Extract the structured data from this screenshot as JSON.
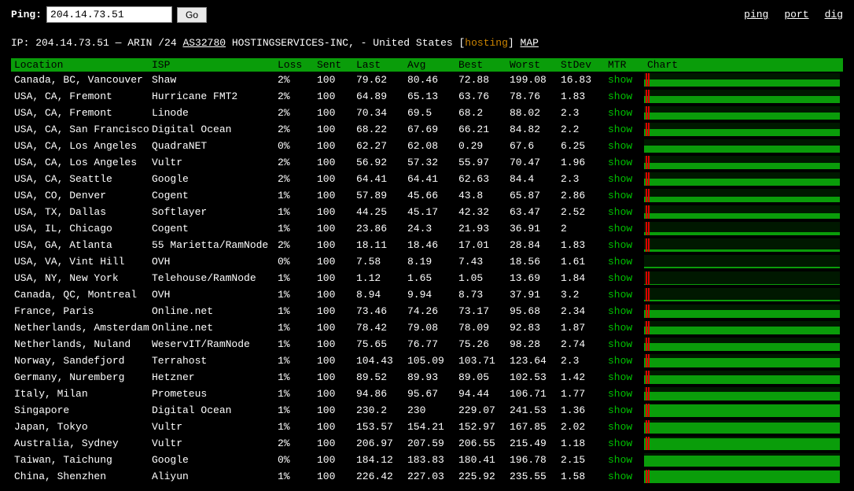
{
  "topbar": {
    "ping_label": "Ping:",
    "ip_value": "204.14.73.51",
    "go_label": "Go",
    "links": {
      "ping": "ping",
      "port": "port",
      "dig": "dig"
    }
  },
  "info": {
    "prefix": "IP: 204.14.73.51 — ARIN /24 ",
    "asn": "AS32780",
    "mid": " HOSTINGSERVICES-INC, - United States [",
    "hosting": "hosting",
    "after_hosting": "] ",
    "map": "MAP"
  },
  "headers": {
    "location": "Location",
    "isp": "ISP",
    "loss": "Loss",
    "sent": "Sent",
    "last": "Last",
    "avg": "Avg",
    "best": "Best",
    "worst": "Worst",
    "stdev": "StDev",
    "mtr": "MTR",
    "chart": "Chart"
  },
  "mtr_label": "show",
  "rows": [
    {
      "location": "Canada, BC, Vancouver",
      "isp": "Shaw",
      "loss": "2%",
      "sent": "100",
      "last": "79.62",
      "avg": "80.46",
      "best": "72.88",
      "worst": "199.08",
      "stdev": "16.83",
      "fill": 55,
      "red": true
    },
    {
      "location": "USA, CA, Fremont",
      "isp": "Hurricane FMT2",
      "loss": "2%",
      "sent": "100",
      "last": "64.89",
      "avg": "65.13",
      "best": "63.76",
      "worst": "78.76",
      "stdev": "1.83",
      "fill": 55,
      "red": true
    },
    {
      "location": "USA, CA, Fremont",
      "isp": "Linode",
      "loss": "2%",
      "sent": "100",
      "last": "70.34",
      "avg": "69.5",
      "best": "68.2",
      "worst": "88.02",
      "stdev": "2.3",
      "fill": 55,
      "red": true
    },
    {
      "location": "USA, CA, San Francisco",
      "isp": "Digital Ocean",
      "loss": "2%",
      "sent": "100",
      "last": "68.22",
      "avg": "67.69",
      "best": "66.21",
      "worst": "84.82",
      "stdev": "2.2",
      "fill": 55,
      "red": true
    },
    {
      "location": "USA, CA, Los Angeles",
      "isp": "QuadraNET",
      "loss": "0%",
      "sent": "100",
      "last": "62.27",
      "avg": "62.08",
      "best": "0.29",
      "worst": "67.6",
      "stdev": "6.25",
      "fill": 55,
      "red": false
    },
    {
      "location": "USA, CA, Los Angeles",
      "isp": "Vultr",
      "loss": "2%",
      "sent": "100",
      "last": "56.92",
      "avg": "57.32",
      "best": "55.97",
      "worst": "70.47",
      "stdev": "1.96",
      "fill": 50,
      "red": true
    },
    {
      "location": "USA, CA, Seattle",
      "isp": "Google",
      "loss": "2%",
      "sent": "100",
      "last": "64.41",
      "avg": "64.41",
      "best": "62.63",
      "worst": "84.4",
      "stdev": "2.3",
      "fill": 55,
      "red": true
    },
    {
      "location": "USA, CO, Denver",
      "isp": "Cogent",
      "loss": "1%",
      "sent": "100",
      "last": "57.89",
      "avg": "45.66",
      "best": "43.8",
      "worst": "65.87",
      "stdev": "2.86",
      "fill": 40,
      "red": true
    },
    {
      "location": "USA, TX, Dallas",
      "isp": "Softlayer",
      "loss": "1%",
      "sent": "100",
      "last": "44.25",
      "avg": "45.17",
      "best": "42.32",
      "worst": "63.47",
      "stdev": "2.52",
      "fill": 40,
      "red": true
    },
    {
      "location": "USA, IL, Chicago",
      "isp": "Cogent",
      "loss": "1%",
      "sent": "100",
      "last": "23.86",
      "avg": "24.3",
      "best": "21.93",
      "worst": "36.91",
      "stdev": "2",
      "fill": 25,
      "red": true
    },
    {
      "location": "USA, GA, Atlanta",
      "isp": "55 Marietta/RamNode",
      "loss": "2%",
      "sent": "100",
      "last": "18.11",
      "avg": "18.46",
      "best": "17.01",
      "worst": "28.84",
      "stdev": "1.83",
      "fill": 20,
      "red": true
    },
    {
      "location": "USA, VA, Vint Hill",
      "isp": "OVH",
      "loss": "0%",
      "sent": "100",
      "last": "7.58",
      "avg": "8.19",
      "best": "7.43",
      "worst": "18.56",
      "stdev": "1.61",
      "fill": 12,
      "red": false
    },
    {
      "location": "USA, NY, New York",
      "isp": "Telehouse/RamNode",
      "loss": "1%",
      "sent": "100",
      "last": "1.12",
      "avg": "1.65",
      "best": "1.05",
      "worst": "13.69",
      "stdev": "1.84",
      "fill": 8,
      "red": true
    },
    {
      "location": "Canada, QC, Montreal",
      "isp": "OVH",
      "loss": "1%",
      "sent": "100",
      "last": "8.94",
      "avg": "9.94",
      "best": "8.73",
      "worst": "37.91",
      "stdev": "3.2",
      "fill": 14,
      "red": true
    },
    {
      "location": "France, Paris",
      "isp": "Online.net",
      "loss": "1%",
      "sent": "100",
      "last": "73.46",
      "avg": "74.26",
      "best": "73.17",
      "worst": "95.68",
      "stdev": "2.34",
      "fill": 58,
      "red": true
    },
    {
      "location": "Netherlands, Amsterdam",
      "isp": "Online.net",
      "loss": "1%",
      "sent": "100",
      "last": "78.42",
      "avg": "79.08",
      "best": "78.09",
      "worst": "92.83",
      "stdev": "1.87",
      "fill": 60,
      "red": true
    },
    {
      "location": "Netherlands, Nuland",
      "isp": "WeservIT/RamNode",
      "loss": "1%",
      "sent": "100",
      "last": "75.65",
      "avg": "76.77",
      "best": "75.26",
      "worst": "98.28",
      "stdev": "2.74",
      "fill": 58,
      "red": true
    },
    {
      "location": "Norway, Sandefjord",
      "isp": "Terrahost",
      "loss": "1%",
      "sent": "100",
      "last": "104.43",
      "avg": "105.09",
      "best": "103.71",
      "worst": "123.64",
      "stdev": "2.3",
      "fill": 70,
      "red": true
    },
    {
      "location": "Germany, Nuremberg",
      "isp": "Hetzner",
      "loss": "1%",
      "sent": "100",
      "last": "89.52",
      "avg": "89.93",
      "best": "89.05",
      "worst": "102.53",
      "stdev": "1.42",
      "fill": 65,
      "red": true
    },
    {
      "location": "Italy, Milan",
      "isp": "Prometeus",
      "loss": "1%",
      "sent": "100",
      "last": "94.86",
      "avg": "95.67",
      "best": "94.44",
      "worst": "106.71",
      "stdev": "1.77",
      "fill": 67,
      "red": true
    },
    {
      "location": "Singapore",
      "isp": "Digital Ocean",
      "loss": "1%",
      "sent": "100",
      "last": "230.2",
      "avg": "230",
      "best": "229.07",
      "worst": "241.53",
      "stdev": "1.36",
      "fill": 95,
      "red": true
    },
    {
      "location": "Japan, Tokyo",
      "isp": "Vultr",
      "loss": "1%",
      "sent": "100",
      "last": "153.57",
      "avg": "154.21",
      "best": "152.97",
      "worst": "167.85",
      "stdev": "2.02",
      "fill": 80,
      "red": true
    },
    {
      "location": "Australia, Sydney",
      "isp": "Vultr",
      "loss": "2%",
      "sent": "100",
      "last": "206.97",
      "avg": "207.59",
      "best": "206.55",
      "worst": "215.49",
      "stdev": "1.18",
      "fill": 90,
      "red": true
    },
    {
      "location": "Taiwan, Taichung",
      "isp": "Google",
      "loss": "0%",
      "sent": "100",
      "last": "184.12",
      "avg": "183.83",
      "best": "180.41",
      "worst": "196.78",
      "stdev": "2.15",
      "fill": 85,
      "red": false
    },
    {
      "location": "China, Shenzhen",
      "isp": "Aliyun",
      "loss": "1%",
      "sent": "100",
      "last": "226.42",
      "avg": "227.03",
      "best": "225.92",
      "worst": "235.55",
      "stdev": "1.58",
      "fill": 94,
      "red": true
    }
  ]
}
